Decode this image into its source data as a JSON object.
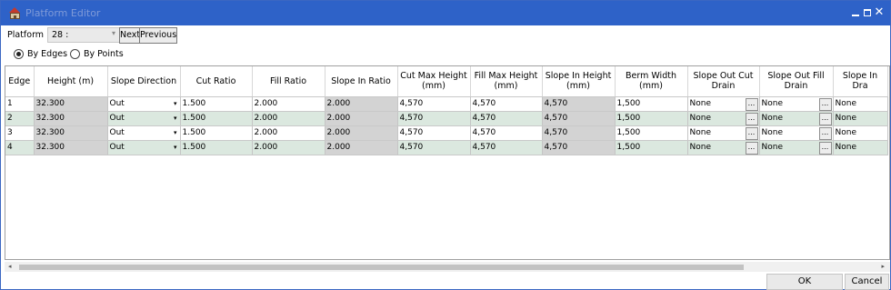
{
  "window": {
    "title": "Platform Editor",
    "icon": "house-icon",
    "controls": {
      "minimize": "—",
      "maximize": "□",
      "close": "✕"
    }
  },
  "toolbar": {
    "platform_label": "Platform",
    "platform_value": "28 :",
    "next_label": "Next",
    "previous_label": "Previous"
  },
  "mode": {
    "by_edges": "By Edges",
    "by_points": "By Points",
    "selected": "By Edges"
  },
  "table": {
    "columns": [
      "Edge",
      "Height (m)",
      "Slope Direction",
      "Cut Ratio",
      "Fill Ratio",
      "Slope In Ratio",
      "Cut Max Height (mm)",
      "Fill Max Height (mm)",
      "Slope In Height (mm)",
      "Berm Width (mm)",
      "Slope Out Cut Drain",
      "Slope Out Fill Drain",
      "Slope In Dra"
    ],
    "rows": [
      {
        "edge": "1",
        "height": "32.300",
        "slope_direction": "Out",
        "cut_ratio": "1.500",
        "fill_ratio": "2.000",
        "slope_in_ratio": "2.000",
        "cut_max_height": "4,570",
        "fill_max_height": "4,570",
        "slope_in_height": "4,570",
        "berm_width": "1,500",
        "slope_out_cut_drain": "None",
        "slope_out_fill_drain": "None",
        "slope_in_drain": "None"
      },
      {
        "edge": "2",
        "height": "32.300",
        "slope_direction": "Out",
        "cut_ratio": "1.500",
        "fill_ratio": "2.000",
        "slope_in_ratio": "2.000",
        "cut_max_height": "4,570",
        "fill_max_height": "4,570",
        "slope_in_height": "4,570",
        "berm_width": "1,500",
        "slope_out_cut_drain": "None",
        "slope_out_fill_drain": "None",
        "slope_in_drain": "None"
      },
      {
        "edge": "3",
        "height": "32.300",
        "slope_direction": "Out",
        "cut_ratio": "1.500",
        "fill_ratio": "2.000",
        "slope_in_ratio": "2.000",
        "cut_max_height": "4,570",
        "fill_max_height": "4,570",
        "slope_in_height": "4,570",
        "berm_width": "1,500",
        "slope_out_cut_drain": "None",
        "slope_out_fill_drain": "None",
        "slope_in_drain": "None"
      },
      {
        "edge": "4",
        "height": "32.300",
        "slope_direction": "Out",
        "cut_ratio": "1.500",
        "fill_ratio": "2.000",
        "slope_in_ratio": "2.000",
        "cut_max_height": "4,570",
        "fill_max_height": "4,570",
        "slope_in_height": "4,570",
        "berm_width": "1,500",
        "slope_out_cut_drain": "None",
        "slope_out_fill_drain": "None",
        "slope_in_drain": "None"
      }
    ],
    "ellipsis": "...",
    "caret": "▾"
  },
  "scrollbar": {
    "left_arrow": "◂",
    "right_arrow": "▸"
  },
  "buttons": {
    "ok": "OK",
    "cancel": "Cancel"
  },
  "colors": {
    "titlebar": "#2e62c8",
    "row_alt": "#dbe8df",
    "readonly": "#d3d3d3"
  }
}
